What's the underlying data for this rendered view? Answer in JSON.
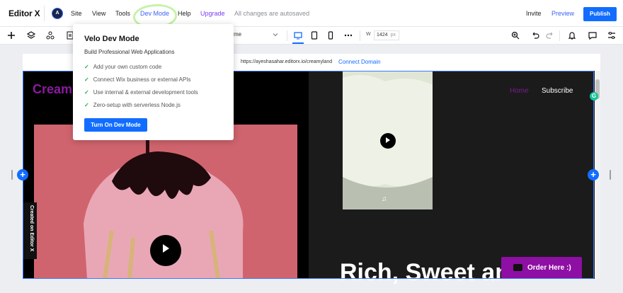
{
  "app": {
    "logo": "Editor X",
    "avatar_initial": "A"
  },
  "menu": {
    "site": "Site",
    "view": "View",
    "tools": "Tools",
    "dev_mode": "Dev Mode",
    "help": "Help",
    "upgrade": "Upgrade",
    "autosave": "All changes are autosaved",
    "invite": "Invite",
    "preview": "Preview",
    "publish": "Publish"
  },
  "toolbar": {
    "page_fragment": "me",
    "width_label": "W",
    "width_value": "1424",
    "width_unit": "px"
  },
  "url_bar": {
    "url": "https://ayeshasahar.editorx.io/creamyland",
    "connect": "Connect Domain"
  },
  "site": {
    "brand": "Cream",
    "nav_home": "Home",
    "nav_subscribe": "Subscribe",
    "headline": "Rich, Sweet and",
    "order_button": "Order Here :)",
    "created_tab": "Created on Editor X",
    "badge": "G"
  },
  "popup": {
    "title": "Velo Dev Mode",
    "subtitle": "Build Professional Web Applications",
    "items": [
      "Add your own custom code",
      "Connect Wix business or external APIs",
      "Use internal & external development tools",
      "Zero-setup with serverless Node.js"
    ],
    "button": "Turn On Dev Mode"
  },
  "colors": {
    "accent": "#116dff",
    "brand": "#8a1c9e",
    "pink_bg": "#d0646e",
    "order_bg": "#8e0fa3"
  }
}
